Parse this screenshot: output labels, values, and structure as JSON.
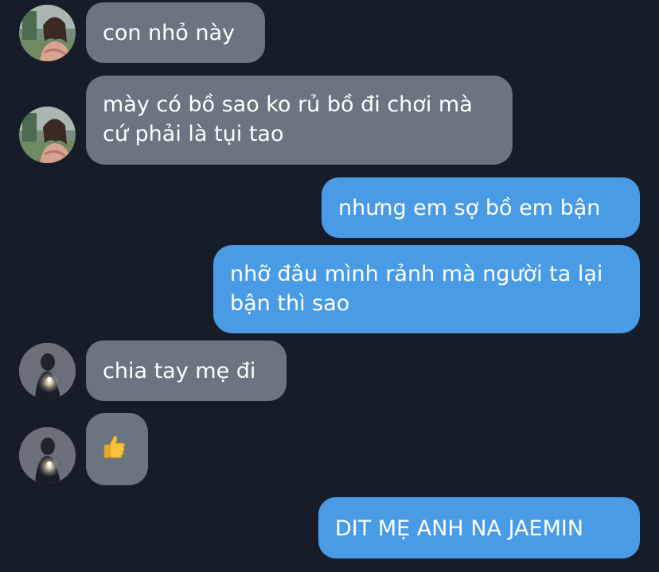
{
  "colors": {
    "background": "#161d29",
    "incoming_bubble": "#6a7581",
    "outgoing_bubble": "#4a9be6",
    "text": "#ffffff"
  },
  "messages": [
    {
      "direction": "incoming",
      "sender_avatar": "girl-photo-avatar",
      "lines": [
        "con nhỏ này"
      ]
    },
    {
      "direction": "incoming",
      "sender_avatar": "girl-photo-avatar",
      "lines": [
        "mày có bồ sao ko rủ bồ đi chơi mà",
        "cứ phải là tụi tao"
      ]
    },
    {
      "direction": "outgoing",
      "lines": [
        "nhưng em sợ bồ em bận"
      ]
    },
    {
      "direction": "outgoing",
      "lines": [
        "nhỡ đâu mình rảnh mà người ta lại",
        "bận thì sao"
      ]
    },
    {
      "direction": "incoming",
      "sender_avatar": "mirror-selfie-avatar",
      "lines": [
        "chia tay mẹ đi"
      ]
    },
    {
      "direction": "incoming",
      "sender_avatar": "mirror-selfie-avatar",
      "lines": [
        "👍"
      ]
    },
    {
      "direction": "outgoing",
      "lines": [
        "DIT MẸ ANH NA JAEMIN"
      ]
    }
  ]
}
